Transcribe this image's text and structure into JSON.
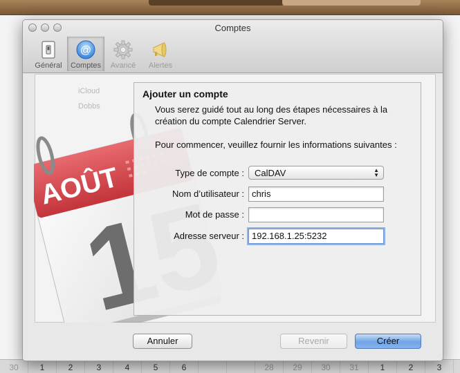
{
  "window": {
    "title": "Comptes"
  },
  "toolbar": {
    "items": [
      {
        "label": "Général",
        "icon": "general-switch-icon"
      },
      {
        "label": "Comptes",
        "icon": "at-sign-icon"
      },
      {
        "label": "Avancé",
        "icon": "gear-icon"
      },
      {
        "label": "Alertes",
        "icon": "megaphone-icon"
      }
    ]
  },
  "background_list": {
    "items": [
      "iCloud",
      "Dobbs"
    ]
  },
  "calendar_icon": {
    "month": "AOÛT",
    "day": "15"
  },
  "sheet": {
    "title": "Ajouter un compte",
    "intro": "Vous serez guidé tout au long des étapes nécessaires à la création du compte Calendrier Server.",
    "prompt": "Pour commencer, veuillez fournir les informations suivantes :",
    "fields": {
      "account_type": {
        "label": "Type de compte :",
        "value": "CalDAV"
      },
      "username": {
        "label": "Nom d’utilisateur :",
        "value": "chris"
      },
      "password": {
        "label": "Mot de passe :",
        "value": ""
      },
      "server": {
        "label": "Adresse serveur :",
        "value": "192.168.1.25:5232"
      }
    }
  },
  "buttons": {
    "cancel": "Annuler",
    "back": "Revenir",
    "create": "Créer"
  },
  "calendar_strip": [
    "30",
    "1",
    "2",
    "3",
    "4",
    "5",
    "6",
    "",
    "",
    "28",
    "29",
    "30",
    "31",
    "1",
    "2",
    "3"
  ],
  "colors": {
    "accent": "#6fa4e6",
    "calendar_red": "#d9434a",
    "focus_ring": "#8fb3e6"
  }
}
